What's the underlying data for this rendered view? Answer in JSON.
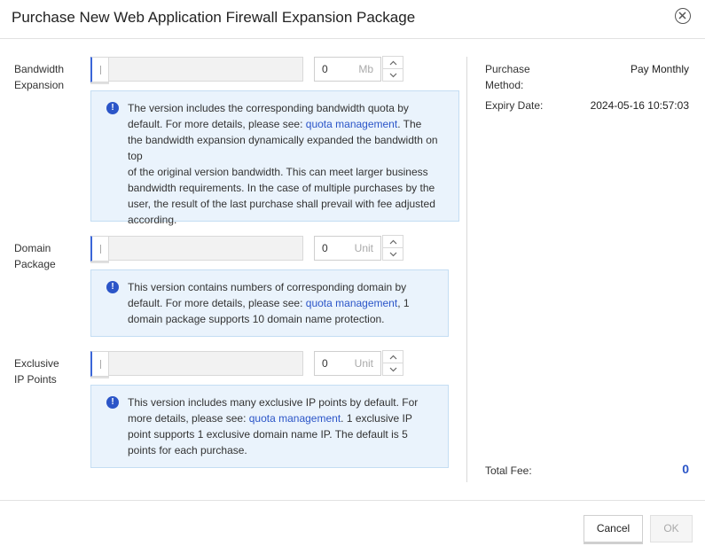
{
  "dialog": {
    "title": "Purchase New Web Application Firewall Expansion Package"
  },
  "bandwidth": {
    "label_line1": "Bandwidth",
    "label_line2": "Expansion",
    "value": "0",
    "unit": "Mb",
    "info_parts": [
      "The version includes the corresponding bandwidth quota by",
      "default. For more details, please see: ",
      "quota management",
      ". The",
      "the bandwidth expansion dynamically expanded the bandwidth on top",
      "of the original version bandwidth. This can meet larger business",
      "bandwidth requirements. In the case of multiple purchases by the",
      "user, the result of the last purchase shall prevail with fee adjusted",
      "according."
    ]
  },
  "domain": {
    "label_line1": "Domain",
    "label_line2": "Package",
    "value": "0",
    "unit": "Unit",
    "info_parts": [
      "This version contains numbers of corresponding domain by",
      "default. For more details, please see: ",
      "quota management",
      ", 1",
      "domain package supports 10 domain name protection."
    ]
  },
  "exclusive_ip": {
    "label_line1": "Exclusive",
    "label_line2": "IP Points",
    "value": "0",
    "unit": "Unit",
    "info_parts": [
      "This version includes many exclusive IP points by default. For",
      "more details, please see: ",
      "quota management",
      ". 1 exclusive IP",
      "point supports 1 exclusive domain name IP. The default is 5",
      "points for each purchase."
    ]
  },
  "summary": {
    "purchase_method_label_line1": "Purchase",
    "purchase_method_label_line2": "Method:",
    "purchase_method_value": "Pay Monthly",
    "expiry_label": "Expiry Date:",
    "expiry_value": "2024-05-16 10:57:03",
    "total_fee_label": "Total Fee:",
    "total_fee_value": "0"
  },
  "footer": {
    "cancel_label": "Cancel",
    "ok_label": "OK"
  },
  "colors": {
    "accent": "#2b55c8",
    "info_bg": "#eaf3fc",
    "info_border": "#c4ddf3"
  },
  "icons": [
    "close-circle-icon",
    "info-icon",
    "chevron-up-icon",
    "chevron-down-icon"
  ]
}
